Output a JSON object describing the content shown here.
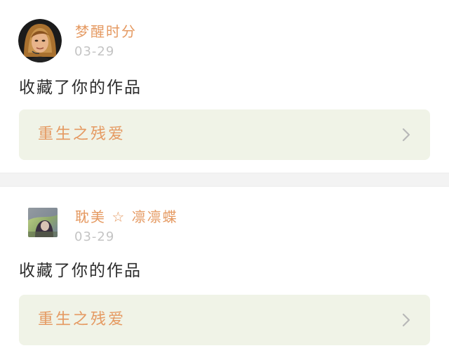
{
  "theme": {
    "accent": "#e59a62",
    "card_background": "#f0f3e7",
    "chevron": "#b8b8b8"
  },
  "feed": [
    {
      "username": "梦醒时分",
      "timestamp": "03-29",
      "action": "收藏了你的作品",
      "work_title": "重生之残爱",
      "avatar_icon": "avatar-portrait-icon"
    },
    {
      "username": "耽美 ☆ 凛凛蝶",
      "timestamp": "03-29",
      "action": "收藏了你的作品",
      "work_title": "重生之残爱",
      "avatar_icon": "avatar-photo-icon"
    }
  ]
}
